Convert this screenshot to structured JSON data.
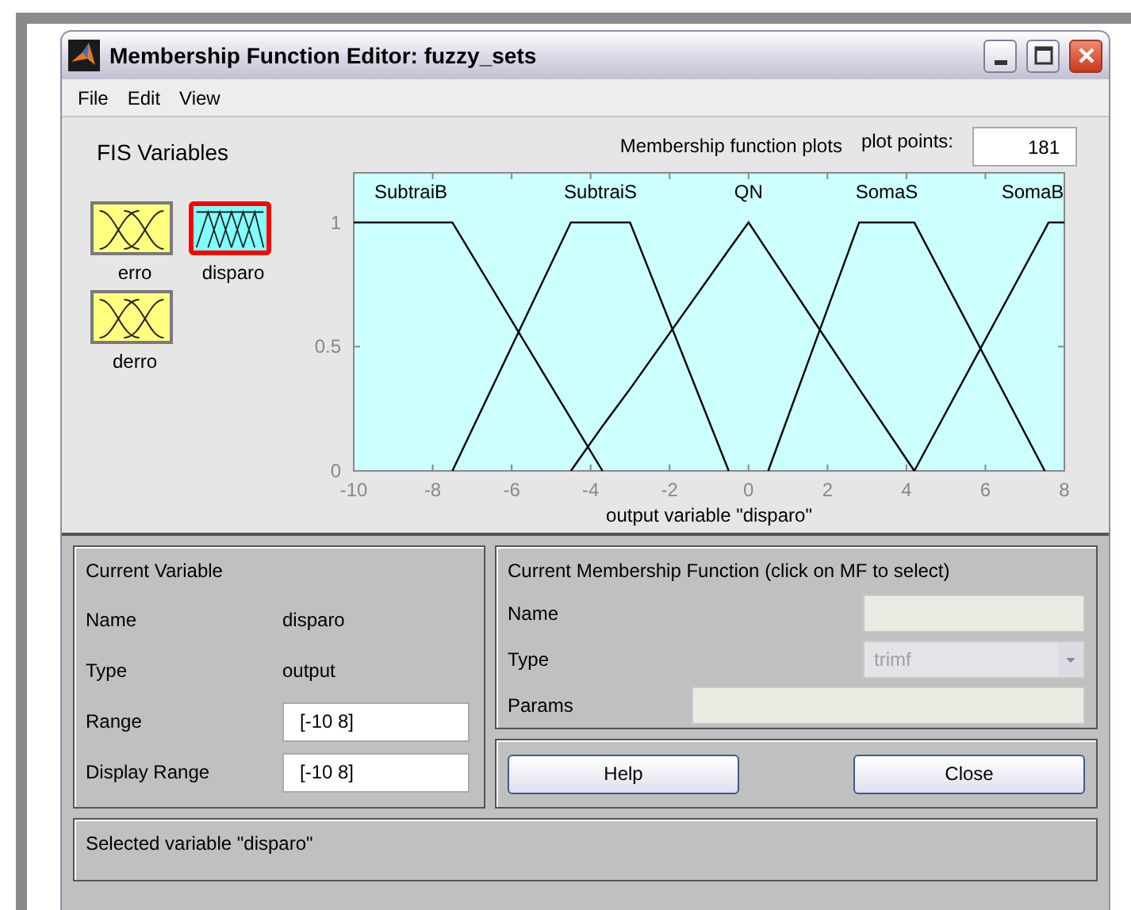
{
  "window": {
    "title": "Membership Function Editor: fuzzy_sets"
  },
  "menu": [
    "File",
    "Edit",
    "View"
  ],
  "fis_variables": {
    "title": "FIS Variables",
    "items": [
      {
        "name": "erro",
        "kind": "input",
        "selected": false
      },
      {
        "name": "disparo",
        "kind": "output",
        "selected": true
      },
      {
        "name": "derro",
        "kind": "input",
        "selected": false
      }
    ]
  },
  "plot_points": {
    "label": "plot points:",
    "value": "181"
  },
  "plot": {
    "chart_data": {
      "type": "line",
      "title": "Membership function plots",
      "xlabel": "output variable \"disparo\"",
      "x": [
        -10,
        -7.5,
        -4.5,
        -3.7,
        -3,
        -0.5,
        0,
        0.5,
        2.8,
        4.2,
        7.5,
        7.6,
        8
      ],
      "series": [
        {
          "name": "SubtraiB",
          "color": "#000000",
          "values": [
            1,
            1,
            0.21,
            0,
            null,
            null,
            null,
            null,
            null,
            null,
            null,
            null,
            null
          ]
        },
        {
          "name": "SubtraiS",
          "color": "#000000",
          "values": [
            null,
            0,
            1,
            1,
            1,
            0,
            null,
            null,
            null,
            null,
            null,
            null,
            null
          ]
        },
        {
          "name": "QN",
          "color": "#000000",
          "values": [
            null,
            null,
            0,
            0.18,
            0.33,
            0.89,
            1,
            0.88,
            0.33,
            0,
            null,
            null,
            null
          ]
        },
        {
          "name": "SomaS",
          "color": "#000000",
          "values": [
            null,
            null,
            null,
            null,
            null,
            null,
            null,
            0,
            1,
            1,
            0,
            null,
            null
          ]
        },
        {
          "name": "SomaB",
          "color": "#000000",
          "values": [
            null,
            null,
            null,
            null,
            null,
            null,
            null,
            null,
            null,
            0,
            0.97,
            1,
            1
          ]
        }
      ],
      "xlim": [
        -10,
        8
      ],
      "ylim": [
        0,
        1.2
      ],
      "xticks": [
        -10,
        -8,
        -6,
        -4,
        -2,
        0,
        2,
        4,
        6,
        8
      ],
      "yticks": [
        0,
        0.5,
        1
      ]
    }
  },
  "current_variable": {
    "title": "Current Variable",
    "fields": [
      {
        "label": "Name",
        "value": "disparo",
        "kind": "text"
      },
      {
        "label": "Type",
        "value": "output",
        "kind": "text"
      },
      {
        "label": "Range",
        "value": "[-10 8]",
        "kind": "input"
      },
      {
        "label": "Display Range",
        "value": "[-10 8]",
        "kind": "input"
      }
    ]
  },
  "current_mf": {
    "title": "Current Membership Function (click on MF to select)",
    "fields": [
      {
        "label": "Name",
        "kind": "input",
        "disabled": true
      },
      {
        "label": "Type",
        "kind": "select",
        "value": "trimf",
        "disabled": true
      },
      {
        "label": "Params",
        "kind": "wide",
        "disabled": true
      }
    ]
  },
  "buttons": [
    "Help",
    "Close"
  ],
  "status": "Selected variable \"disparo\""
}
